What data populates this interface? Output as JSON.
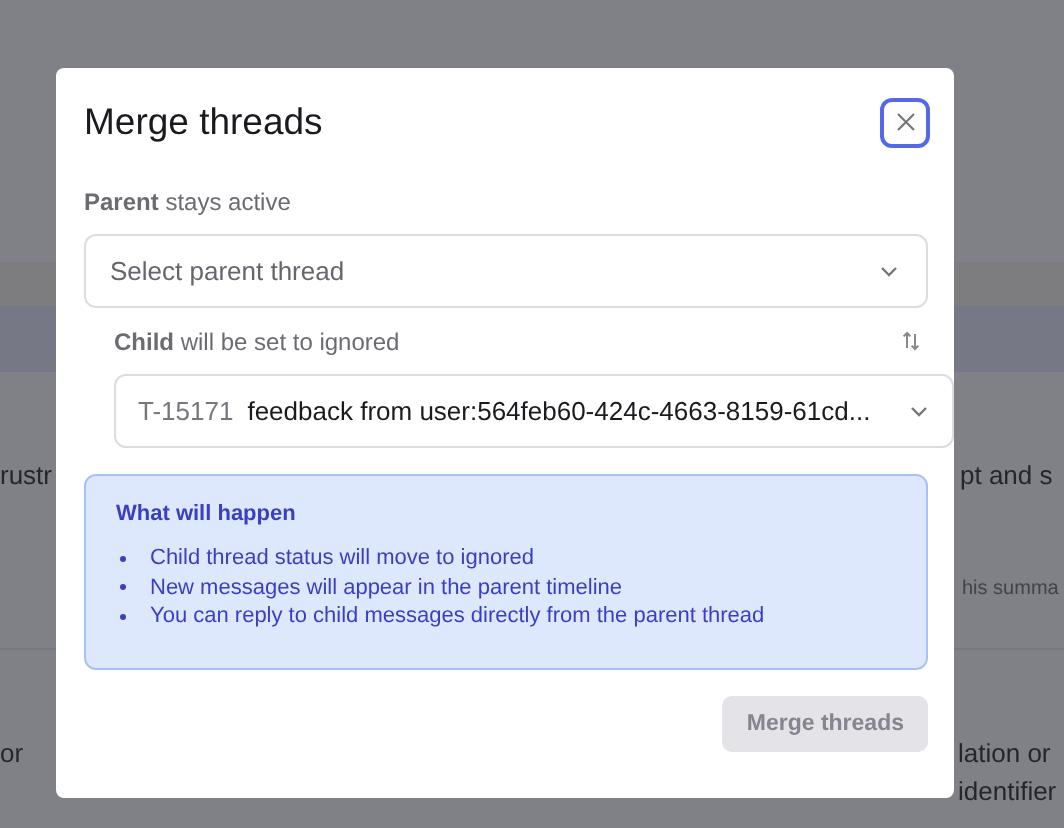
{
  "backdrop": {
    "fragments": [
      "rustr",
      "pt and s",
      "his summa",
      "or",
      "lation or",
      "identifier"
    ]
  },
  "dialog": {
    "title": "Merge threads",
    "parent": {
      "label": "**Parent** stays active",
      "placeholder": "Select parent thread"
    },
    "child": {
      "label": "**Child** will be set to ignored",
      "thread_id": "T-15171",
      "value": "feedback from user:564feb60-424c-4663-8159-61cd..."
    },
    "info": {
      "title": "What will happen",
      "items": [
        "Child thread status will move to ignored",
        "New messages will appear in the parent timeline",
        "You can reply to child messages directly from the parent thread"
      ]
    },
    "button": {
      "label": "Merge threads",
      "disabled": true
    }
  }
}
